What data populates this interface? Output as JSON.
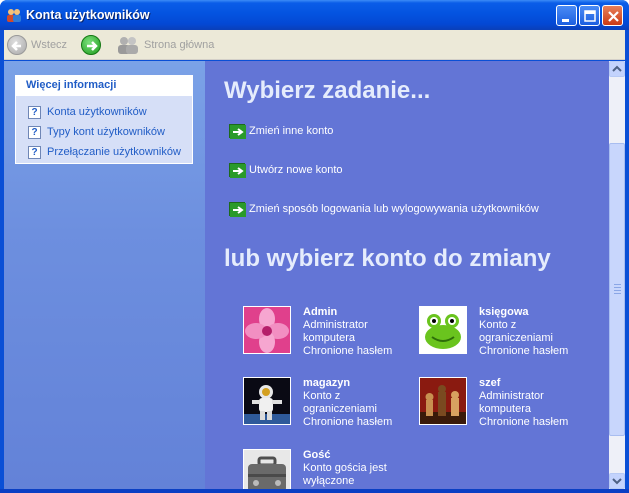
{
  "window": {
    "title": "Konta użytkowników"
  },
  "colors": {
    "title_bar": "#0453e0",
    "side_pane": "#6d8fdf",
    "main_pane": "#6375d6",
    "link": "#215dc6"
  },
  "toolbar": {
    "back_label": "Wstecz",
    "forward_icon": "forward-arrow-icon",
    "home_label": "Strona główna"
  },
  "sidebar": {
    "box_title": "Więcej informacji",
    "items": [
      {
        "label": "Konta użytkowników",
        "icon": "help-icon"
      },
      {
        "label": "Typy kont użytkowników",
        "icon": "help-icon"
      },
      {
        "label": "Przełączanie użytkowników",
        "icon": "help-icon"
      }
    ]
  },
  "main": {
    "heading": "Wybierz zadanie...",
    "tasks": [
      {
        "label": "Zmień inne konto"
      },
      {
        "label": "Utwórz nowe konto"
      },
      {
        "label": "Zmień sposób logowania lub wylogowywania użytkowników"
      }
    ],
    "accounts_heading": "lub wybierz konto do zmiany",
    "accounts": [
      {
        "name": "Admin",
        "lines": [
          "Administrator",
          "komputera",
          "Chronione hasłem"
        ],
        "picture": "flower-picture"
      },
      {
        "name": "księgowa",
        "lines": [
          "Konto z",
          "ograniczeniami",
          "Chronione hasłem"
        ],
        "picture": "frog-picture"
      },
      {
        "name": "magazyn",
        "lines": [
          "Konto z",
          "ograniczeniami",
          "Chronione hasłem"
        ],
        "picture": "astronaut-picture"
      },
      {
        "name": "szef",
        "lines": [
          "Administrator",
          "komputera",
          "Chronione hasłem"
        ],
        "picture": "chess-picture"
      },
      {
        "name": "Gość",
        "lines": [
          "Konto gościa jest",
          "wyłączone"
        ],
        "picture": "suitcase-picture"
      }
    ]
  }
}
